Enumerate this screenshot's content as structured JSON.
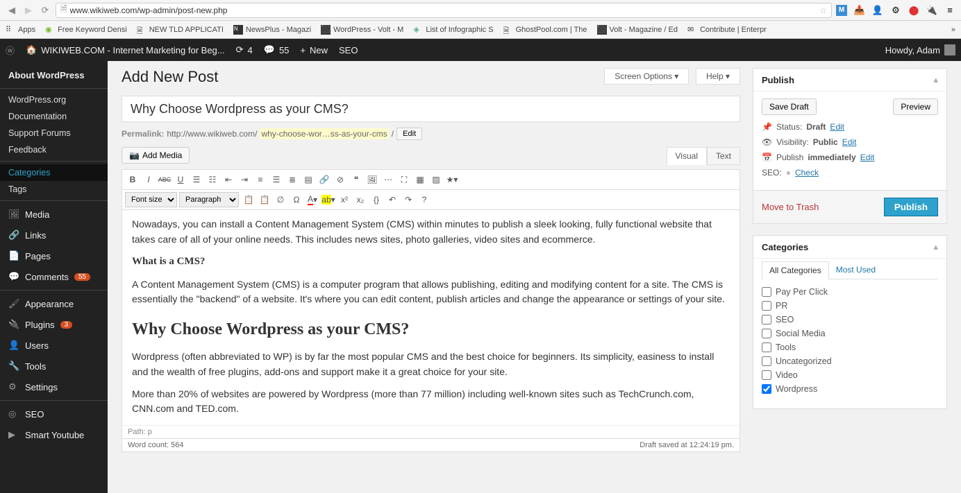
{
  "browser": {
    "url": "www.wikiweb.com/wp-admin/post-new.php",
    "bookmarks": [
      "Apps",
      "Free Keyword Densi",
      "NEW TLD APPLICATI",
      "NewsPlus - Magazi",
      "WordPress - Volt - M",
      "List of Infographic S",
      "GhostPool.com | The",
      "Volt - Magazine / Ed",
      "Contribute | Enterpr"
    ]
  },
  "adminbar": {
    "site": "WIKIWEB.COM - Internet Marketing for Beg...",
    "updates": "4",
    "comments": "55",
    "new": "New",
    "seo": "SEO",
    "howdy": "Howdy, Adam"
  },
  "sidebar": {
    "about": "About WordPress",
    "items1": [
      "WordPress.org",
      "Documentation",
      "Support Forums",
      "Feedback"
    ],
    "categories": "Categories",
    "tags": "Tags",
    "media": "Media",
    "links": "Links",
    "pages": "Pages",
    "comments": "Comments",
    "comments_badge": "55",
    "appearance": "Appearance",
    "plugins": "Plugins",
    "plugins_badge": "3",
    "users": "Users",
    "tools": "Tools",
    "settings": "Settings",
    "seo": "SEO",
    "smart": "Smart Youtube"
  },
  "screen": {
    "options": "Screen Options",
    "help": "Help"
  },
  "page": {
    "title": "Add New Post",
    "post_title": "Why Choose Wordpress as your CMS?",
    "permalink_label": "Permalink:",
    "permalink_base": "http://www.wikiweb.com/",
    "permalink_slug": "why-choose-wor…ss-as-your-cms",
    "edit": "Edit",
    "add_media": "Add Media",
    "visual": "Visual",
    "text": "Text",
    "fontsize": "Font size",
    "paragraph": "Paragraph",
    "body_p1": "Nowadays, you can install a Content Management System (CMS) within minutes to publish a sleek looking, fully functional website that takes care of all of your online needs. This includes news sites, photo galleries, video sites and ecommerce.",
    "body_h3": "What is a CMS?",
    "body_p2": "A Content Management System (CMS) is a computer program that allows publishing, editing and modifying content for a site. The CMS is essentially the \"backend\" of a website. It's where you can edit content, publish articles and change the appearance or settings of your site.",
    "body_h2": "Why Choose Wordpress as your CMS?",
    "body_p3": "Wordpress (often abbreviated to WP) is by far the most popular CMS and the best choice for beginners. Its simplicity, easiness to install and the wealth of free plugins, add-ons and support make it a great choice for your site.",
    "body_p4": "More than 20% of websites are powered by Wordpress (more than 77 million) including well-known sites such as TechCrunch.com, CNN.com and TED.com.",
    "path": "Path: p",
    "word_count": "Word count: 564",
    "draft_saved": "Draft saved at 12:24:19 pm."
  },
  "publish": {
    "title": "Publish",
    "save_draft": "Save Draft",
    "preview": "Preview",
    "status_label": "Status:",
    "status_value": "Draft",
    "visibility_label": "Visibility:",
    "visibility_value": "Public",
    "publish_label": "Publish",
    "publish_value": "immediately",
    "seo_label": "SEO:",
    "seo_check": "Check",
    "edit": "Edit",
    "trash": "Move to Trash",
    "publish_btn": "Publish"
  },
  "categories": {
    "title": "Categories",
    "tab_all": "All Categories",
    "tab_used": "Most Used",
    "items": [
      {
        "label": "Pay Per Click",
        "checked": false
      },
      {
        "label": "PR",
        "checked": false
      },
      {
        "label": "SEO",
        "checked": false
      },
      {
        "label": "Social Media",
        "checked": false
      },
      {
        "label": "Tools",
        "checked": false
      },
      {
        "label": "Uncategorized",
        "checked": false
      },
      {
        "label": "Video",
        "checked": false
      },
      {
        "label": "Wordpress",
        "checked": true
      }
    ]
  }
}
